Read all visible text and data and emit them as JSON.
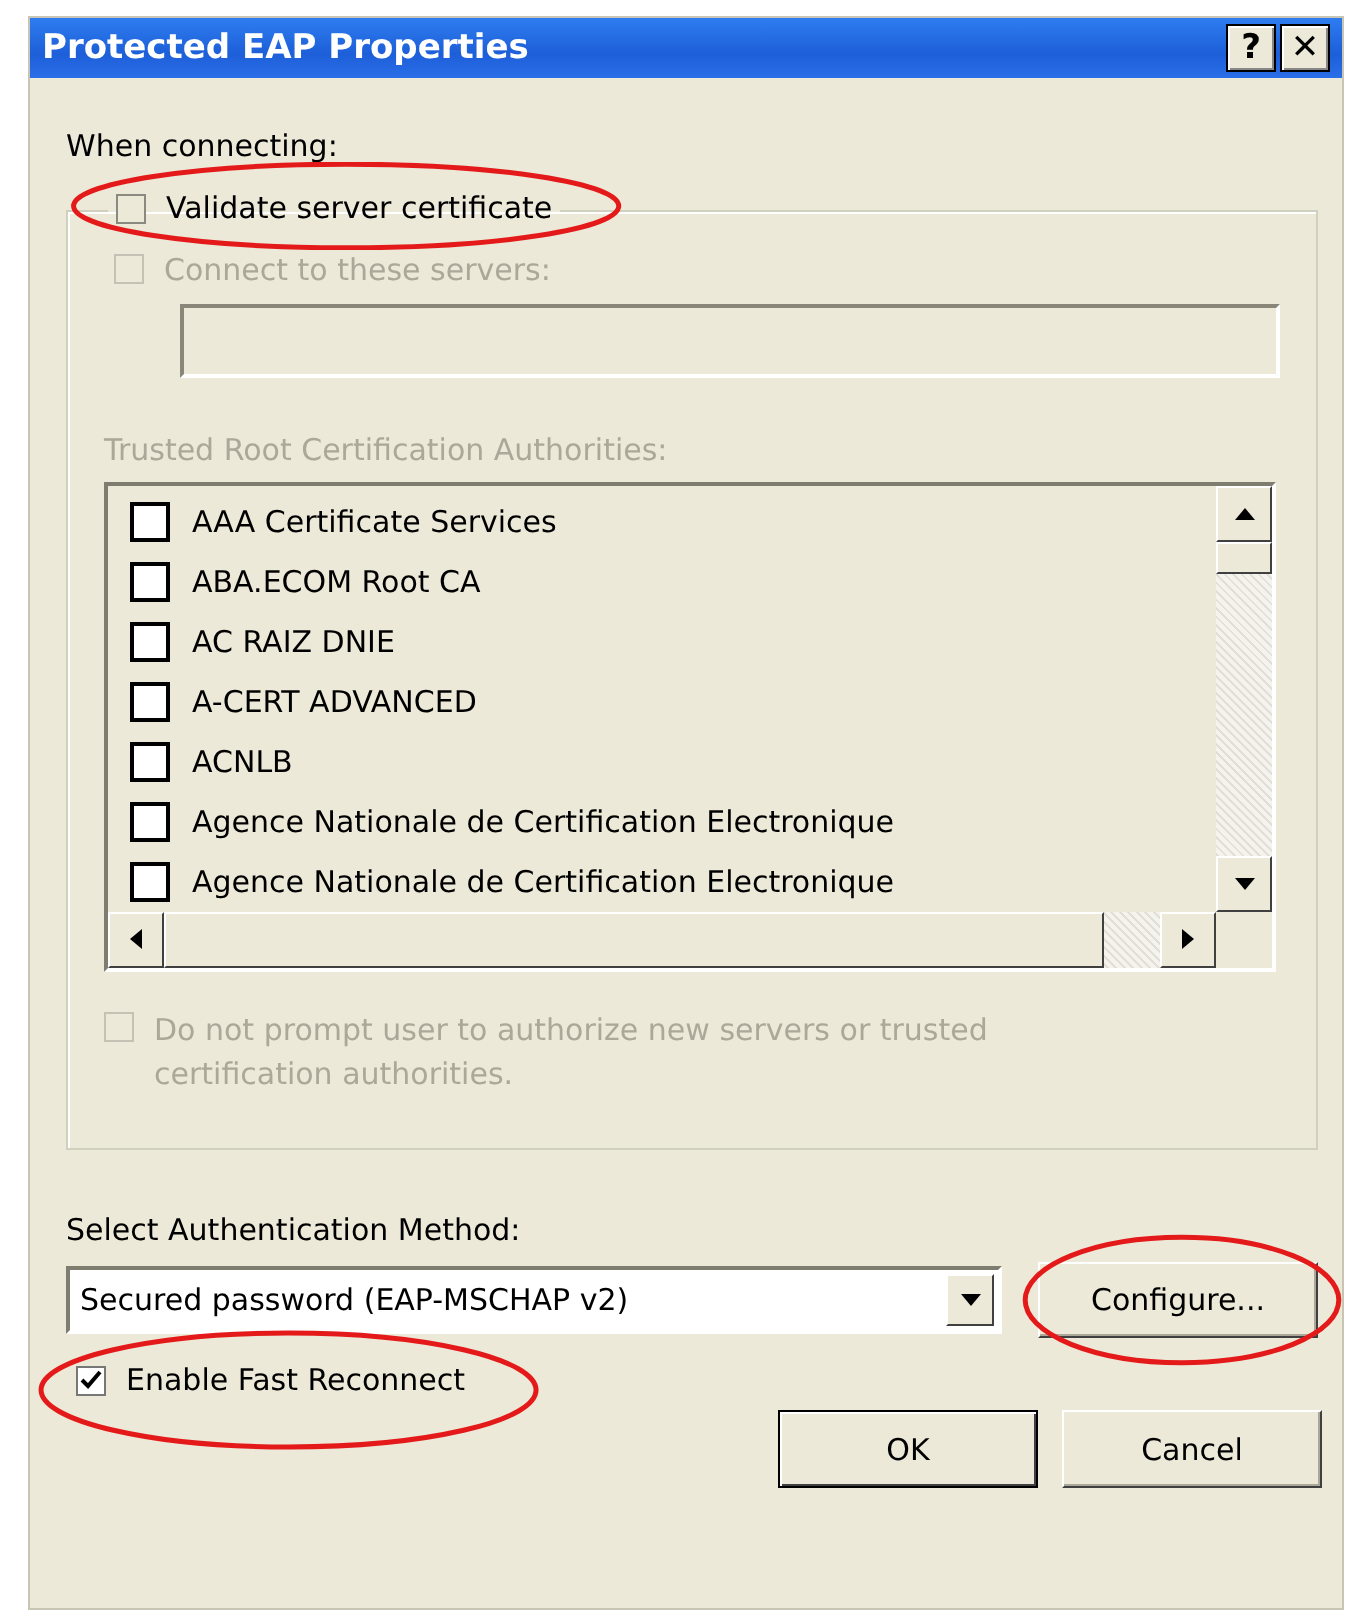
{
  "window": {
    "title": "Protected EAP Properties",
    "buttons": [
      "?",
      "✕"
    ]
  },
  "when_connecting_label": "When connecting:",
  "validate_server_certificate": {
    "label": "Validate server certificate",
    "checked": false,
    "highlighted": true
  },
  "connect_to_servers": {
    "label": "Connect to these servers:",
    "checked": false,
    "disabled": true
  },
  "servers_field": {
    "disabled": true
  },
  "trusted_roots": {
    "label": "Trusted Root Certification Authorities:",
    "disabled": true,
    "items": [
      {
        "name": "AAA Certificate Services",
        "checked": false
      },
      {
        "name": "ABA.ECOM Root CA",
        "checked": false
      },
      {
        "name": "AC RAIZ DNIE",
        "checked": false
      },
      {
        "name": "A-CERT ADVANCED",
        "checked": false
      },
      {
        "name": "ACNLB",
        "checked": false
      },
      {
        "name": "Agence Nationale de Certification Electronique",
        "checked": false
      },
      {
        "name": "Agence Nationale de Certification Electronique",
        "checked": false
      }
    ]
  },
  "no_prompt": {
    "label": "Do not prompt user to authorize new servers or trusted certification authorities.",
    "checked": false,
    "disabled": true
  },
  "auth_method": {
    "label": "Select Authentication Method:",
    "value": "Secured password (EAP-MSCHAP v2)"
  },
  "configure_button": {
    "label": "Configure...",
    "highlighted": true
  },
  "fast_reconnect": {
    "label": "Enable Fast Reconnect",
    "checked": true,
    "highlighted": true
  },
  "buttons": [
    {
      "label": "OK",
      "default": true
    },
    {
      "label": "Cancel",
      "default": false
    }
  ]
}
